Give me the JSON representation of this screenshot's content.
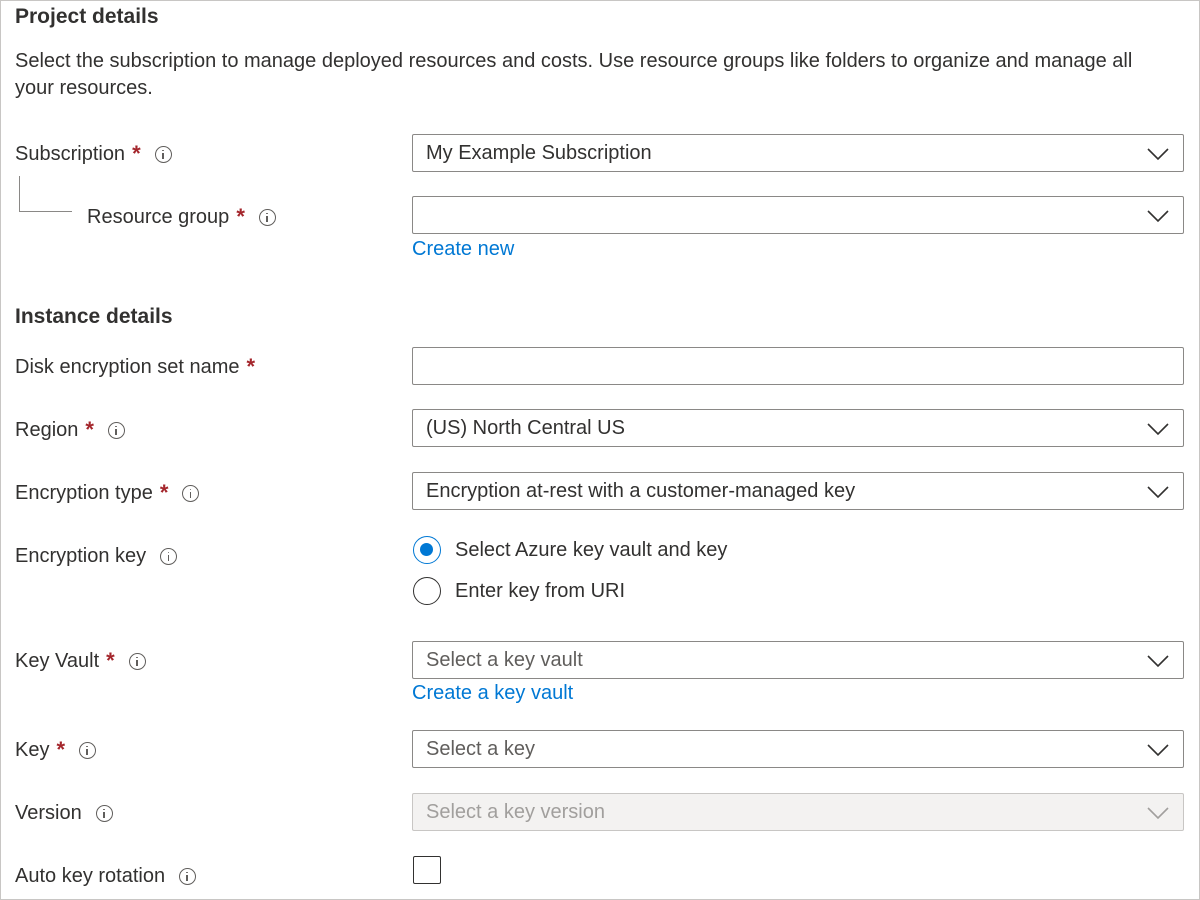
{
  "project": {
    "title": "Project details",
    "description": "Select the subscription to manage deployed resources and costs. Use resource groups like folders to organize and manage all your resources."
  },
  "subscription": {
    "label": "Subscription",
    "required": "*",
    "value": "My Example Subscription"
  },
  "resource_group": {
    "label": "Resource group",
    "required": "*",
    "value": "",
    "create_link": "Create new"
  },
  "instance": {
    "title": "Instance details"
  },
  "disk_name": {
    "label": "Disk encryption set name",
    "required": "*",
    "value": ""
  },
  "region": {
    "label": "Region",
    "required": "*",
    "value": "(US) North Central US"
  },
  "encryption_type": {
    "label": "Encryption type",
    "required": "*",
    "value": "Encryption at-rest with a customer-managed key"
  },
  "encryption_key": {
    "label": "Encryption key",
    "options": [
      {
        "label": "Select Azure key vault and key",
        "selected": true
      },
      {
        "label": "Enter key from URI",
        "selected": false
      }
    ]
  },
  "key_vault": {
    "label": "Key Vault",
    "required": "*",
    "placeholder": "Select a key vault",
    "create_link": "Create a key vault"
  },
  "key": {
    "label": "Key",
    "required": "*",
    "placeholder": "Select a key"
  },
  "version": {
    "label": "Version",
    "placeholder": "Select a key version",
    "disabled": true
  },
  "auto_rotation": {
    "label": "Auto key rotation",
    "checked": false
  },
  "colors": {
    "accent": "#0078d4",
    "required": "#a4262c",
    "text": "#323130",
    "border": "#8a8886"
  },
  "icons": [
    "info-icon",
    "chevron-down-icon"
  ]
}
